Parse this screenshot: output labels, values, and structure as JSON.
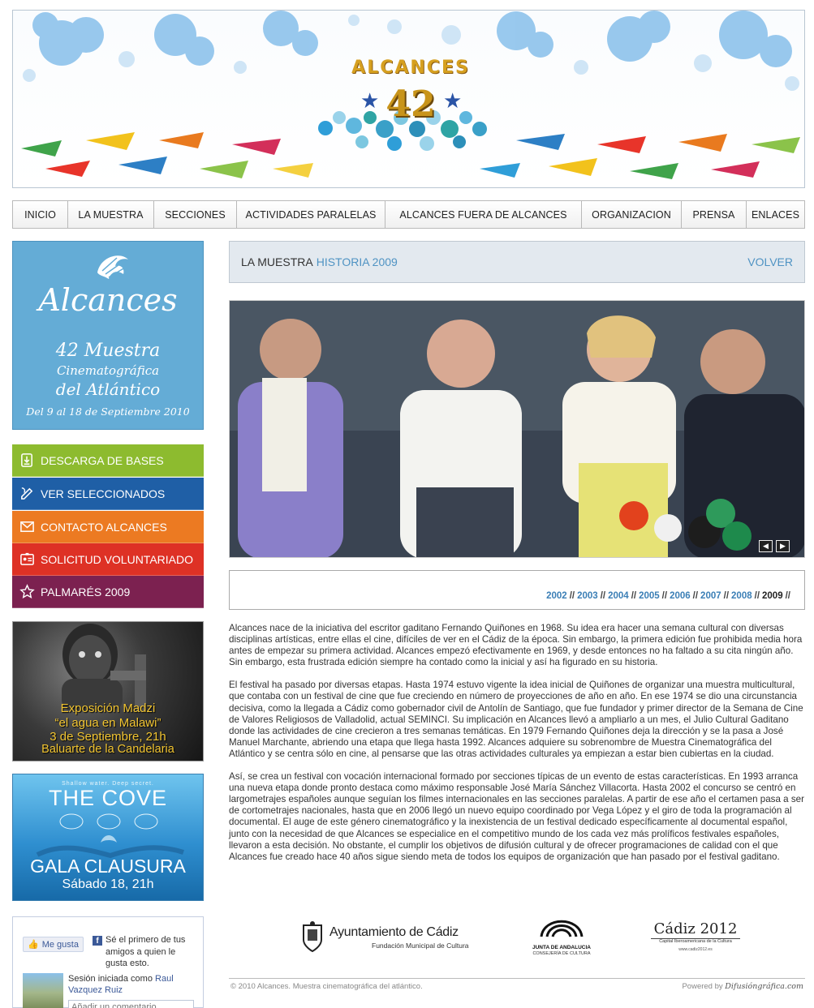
{
  "banner": {
    "title": "ALCANCES",
    "number": "42"
  },
  "nav": {
    "items": [
      {
        "label": "INICIO",
        "width": 1
      },
      {
        "label": "LA MUESTRA"
      },
      {
        "label": "SECCIONES"
      },
      {
        "label": "ACTIVIDADES PARALELAS"
      },
      {
        "label": "ALCANCES FUERA DE ALCANCES"
      },
      {
        "label": "ORGANIZACION"
      },
      {
        "label": "PRENSA"
      },
      {
        "label": "ENLACES"
      }
    ]
  },
  "promo": {
    "brand": "Alcances",
    "line1": "42 Muestra",
    "line2": "Cinematográfica",
    "line3": "del Atlántico",
    "line4": "Del 9 al 18 de Septiembre 2010"
  },
  "side_buttons": [
    {
      "label": "DESCARGA DE BASES",
      "color": "#8dbb2f",
      "icon": "download-doc-icon"
    },
    {
      "label": "VER SELECCIONADOS",
      "color": "#1f5fa6",
      "icon": "pencil-icon"
    },
    {
      "label": "CONTACTO ALCANCES",
      "color": "#ec7a22",
      "icon": "envelope-icon"
    },
    {
      "label": "SOLICITUD VOLUNTARIADO",
      "color": "#de3125",
      "icon": "id-card-icon"
    },
    {
      "label": "PALMARÉS 2009",
      "color": "#7c2150",
      "icon": "star-icon"
    }
  ],
  "poster_madzi": {
    "line1": "Exposición Madzi",
    "line2": "“el agua en Malawi”",
    "line3": "3 de Septiembre, 21h",
    "line4": "Baluarte de la Candelaria"
  },
  "poster_cove": {
    "tagline": "Shallow water. Deep secret.",
    "title": "THE COVE",
    "gala": "GALA CLAUSURA",
    "date": "Sábado 18, 21h"
  },
  "facebook": {
    "like_label": "Me gusta",
    "first_text": "Sé el primero de tus amigos a quien le gusta esto.",
    "session_prefix": "Sesión iniciada como",
    "user_name": "Raul Vazquez Ruiz",
    "comment_placeholder": "Añadir un comentario..."
  },
  "section_header": {
    "crumb1": "LA MUESTRA",
    "crumb2": "HISTORIA 2009",
    "back": "VOLVER"
  },
  "years": {
    "links": [
      "2002",
      "2003",
      "2004",
      "2005",
      "2006",
      "2007",
      "2008"
    ],
    "current": "2009",
    "separator": "//"
  },
  "article": {
    "paragraphs": [
      "Alcances nace de la iniciativa del escritor gaditano Fernando Quiñones en 1968. Su idea era hacer una semana cultural con diversas disciplinas artísticas, entre ellas el cine, difíciles de ver en el Cádiz de la época. Sin embargo, la primera edición fue prohibida media hora antes de empezar su primera actividad. Alcances empezó efectivamente en 1969, y desde entonces no ha faltado a su cita ningún año. Sin embargo, esta frustrada edición siempre ha contado como la inicial y así ha figurado en su historia.",
      "El festival ha pasado por diversas etapas. Hasta 1974 estuvo vigente la idea inicial de Quiñones de organizar una muestra multicultural, que contaba con un festival de cine que fue creciendo en número de proyecciones de año en año. En ese 1974 se dio una circunstancia decisiva, como la llegada a Cádiz como gobernador civil de Antolín de Santiago, que fue fundador y primer director de la Semana de Cine de Valores Religiosos de Valladolid, actual SEMINCI. Su implicación en Alcances llevó a ampliarlo a un mes, el Julio Cultural Gaditano donde las actividades de cine crecieron a tres semanas temáticas. En 1979 Fernando Quiñones deja la dirección y se la pasa a José Manuel Marchante, abriendo una etapa que llega hasta 1992. Alcances adquiere su sobrenombre de Muestra Cinematográfica del Atlántico y se centra sólo en cine, al pensarse que las otras actividades culturales ya empiezan a estar bien cubiertas en la ciudad.",
      "Así, se crea un festival con vocación internacional formado por secciones típicas de un evento de estas características. En 1993 arranca una nueva etapa donde pronto destaca como máximo responsable José María Sánchez Villacorta. Hasta 2002 el concurso se centró en largometrajes españoles aunque seguían los filmes internacionales en las secciones paralelas. A partir de ese año el certamen pasa a ser de cortometrajes nacionales, hasta que en 2006 llegó un nuevo equipo coordinado por Vega López y el giro de toda la programación al documental. El auge de este género cinematográfico y la inexistencia de un festival dedicado específicamente al documental español, junto con la necesidad de que Alcances se especialice en el competitivo mundo de los cada vez más prolíficos festivales españoles, llevaron a esta decisión. No obstante, el cumplir los objetivos de difusión cultural y de ofrecer programaciones de calidad con el que Alcances fue creado hace 40 años sigue siendo meta de todos los equipos de organización que han pasado por el festival gaditano."
    ]
  },
  "sponsors": {
    "cadiz_name": "Ayuntamiento de Cádiz",
    "cadiz_sub": "Fundación Municipal de Cultura",
    "junta_name": "JUNTA DE ANDALUCIA",
    "junta_sub": "CONSEJERÍA DE CULTURA",
    "c2012_name": "Cádiz 2012",
    "c2012_sub": "Capital Iberoamericana de la Cultura",
    "c2012_url": "www.cadiz2012.es"
  },
  "footer": {
    "copyright": "© 2010 Alcances. Muestra cinematográfica del atlántico.",
    "powered_prefix": "Powered by",
    "powered_name": "Difusióngráfica.com"
  }
}
